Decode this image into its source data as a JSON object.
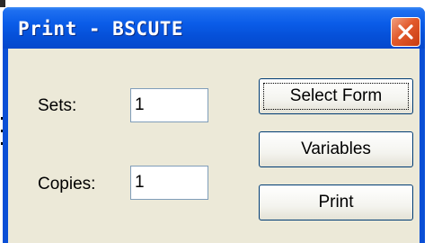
{
  "window": {
    "title": "Print - BSCUTE"
  },
  "form": {
    "sets_label": "Sets:",
    "sets_value": "1",
    "copies_label": "Copies:",
    "copies_value": "1"
  },
  "buttons": {
    "select_form": "Select Form",
    "variables": "Variables",
    "print": "Print"
  },
  "icons": {
    "close": "close-icon"
  },
  "colors": {
    "titlebar": "#0a5ce8",
    "dialog_bg": "#ece9d8",
    "close_button": "#e25a2c"
  }
}
